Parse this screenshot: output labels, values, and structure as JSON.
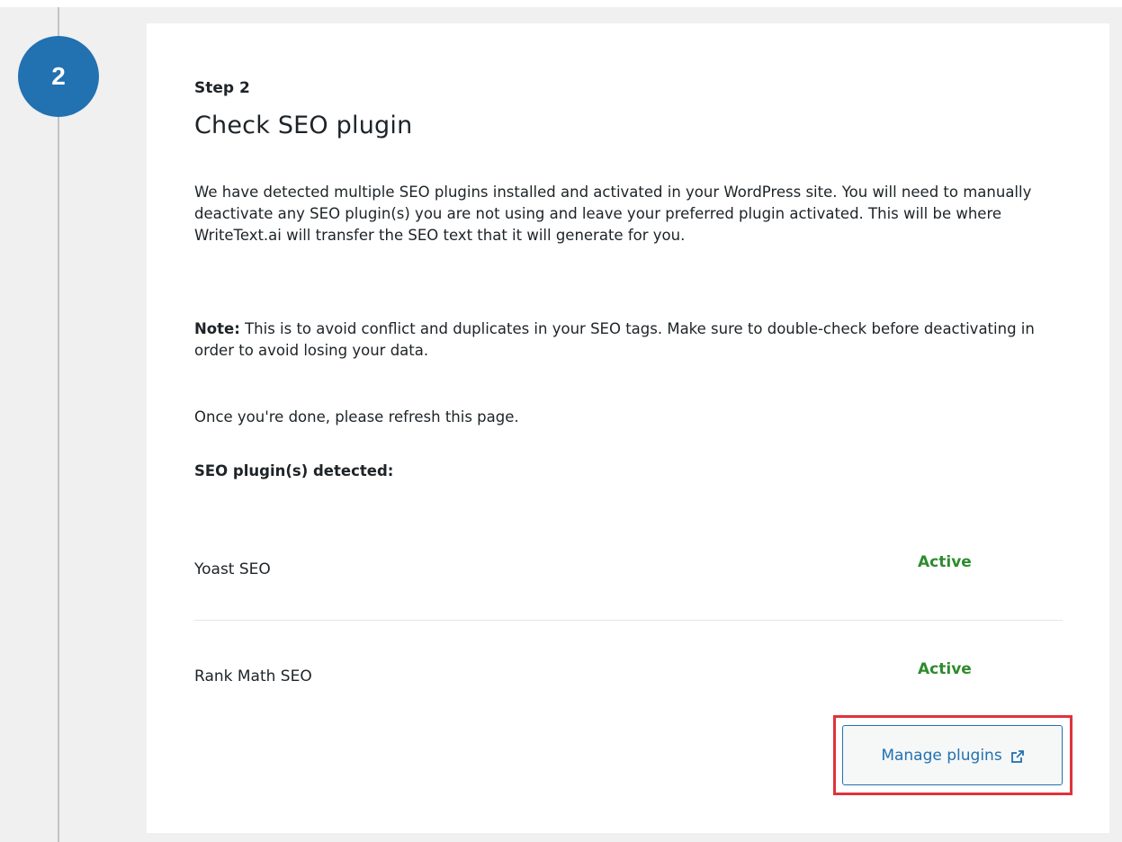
{
  "step": {
    "number": "2",
    "label": "Step 2",
    "title": "Check SEO plugin"
  },
  "content": {
    "paragraph1": "We have detected multiple SEO plugins installed and activated in your WordPress site. You will need to manually deactivate any SEO plugin(s) you are not using and leave your preferred plugin activated. This will be where WriteText.ai will transfer the SEO text that it will generate for you.",
    "note_label": "Note:",
    "note_text": " This is to avoid conflict and duplicates in your SEO tags. Make sure to double-check before deactivating in order to avoid losing your data.",
    "paragraph3": "Once you're done, please refresh this page.",
    "detected_heading": "SEO plugin(s) detected:"
  },
  "plugins": [
    {
      "name": "Yoast SEO",
      "status": "Active"
    },
    {
      "name": "Rank Math SEO",
      "status": "Active"
    }
  ],
  "actions": {
    "manage_label": "Manage plugins"
  },
  "icons": {
    "external": "external-link-icon"
  },
  "colors": {
    "accent": "#2271b1",
    "active_status": "#2e8b2e",
    "highlight": "#e0333b"
  }
}
